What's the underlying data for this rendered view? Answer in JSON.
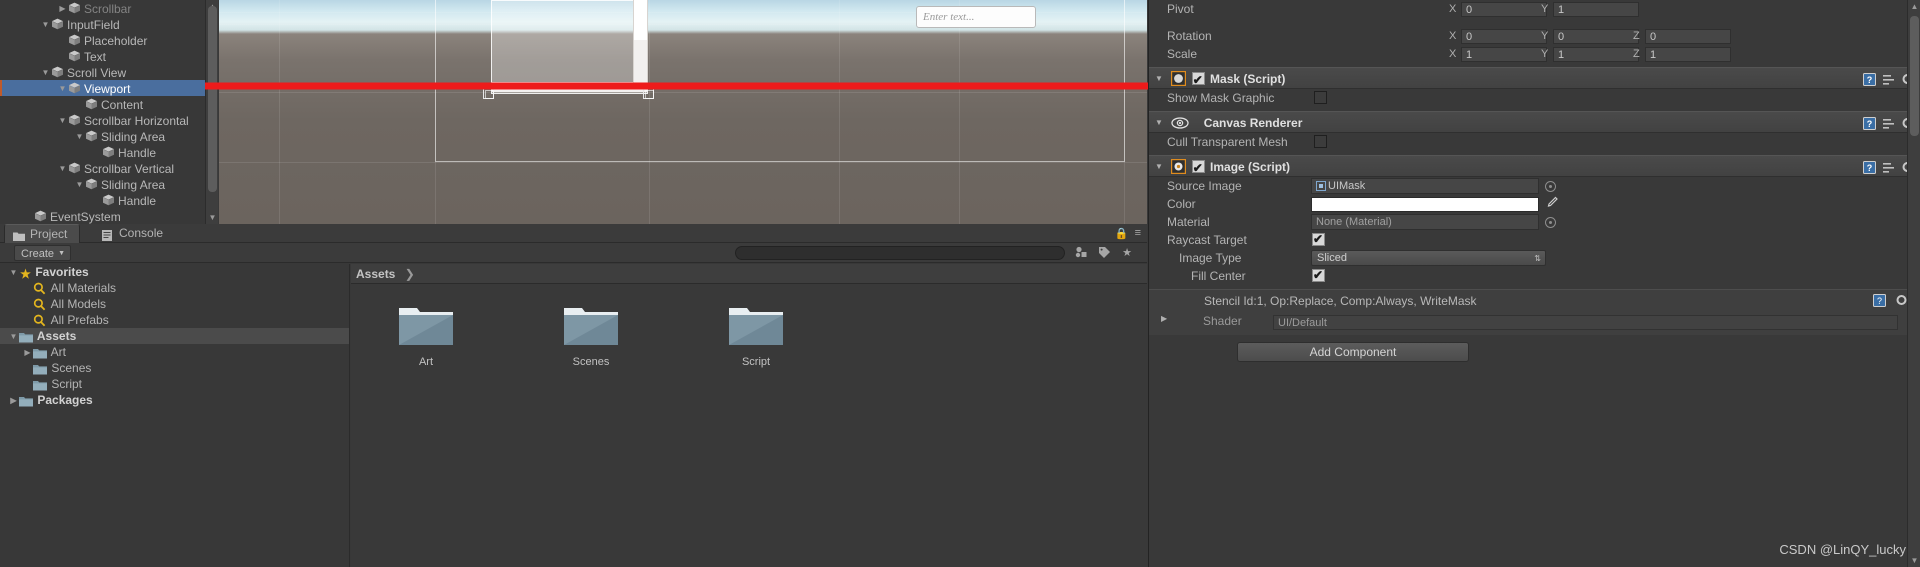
{
  "hierarchy": {
    "items": [
      {
        "label": "Scrollbar",
        "indent": 3,
        "tri": "right",
        "dim": true,
        "selected": false
      },
      {
        "label": "InputField",
        "indent": 2,
        "tri": "down",
        "dim": false,
        "selected": false
      },
      {
        "label": "Placeholder",
        "indent": 3,
        "tri": "none",
        "dim": false,
        "selected": false
      },
      {
        "label": "Text",
        "indent": 3,
        "tri": "none",
        "dim": false,
        "selected": false
      },
      {
        "label": "Scroll View",
        "indent": 2,
        "tri": "down",
        "dim": false,
        "selected": false
      },
      {
        "label": "Viewport",
        "indent": 3,
        "tri": "down",
        "dim": false,
        "selected": true
      },
      {
        "label": "Content",
        "indent": 4,
        "tri": "none",
        "dim": false,
        "selected": false
      },
      {
        "label": "Scrollbar Horizontal",
        "indent": 3,
        "tri": "down",
        "dim": false,
        "selected": false
      },
      {
        "label": "Sliding Area",
        "indent": 4,
        "tri": "down",
        "dim": false,
        "selected": false
      },
      {
        "label": "Handle",
        "indent": 5,
        "tri": "none",
        "dim": false,
        "selected": false
      },
      {
        "label": "Scrollbar Vertical",
        "indent": 3,
        "tri": "down",
        "dim": false,
        "selected": false
      },
      {
        "label": "Sliding Area",
        "indent": 4,
        "tri": "down",
        "dim": false,
        "selected": false
      },
      {
        "label": "Handle",
        "indent": 5,
        "tri": "none",
        "dim": false,
        "selected": false
      },
      {
        "label": "EventSystem",
        "indent": 1,
        "tri": "none",
        "dim": false,
        "selected": false
      }
    ]
  },
  "scene": {
    "input_field_placeholder": "Enter text..."
  },
  "project": {
    "tabs": [
      {
        "label": "Project",
        "icon": "folder-icon",
        "active": true
      },
      {
        "label": "Console",
        "icon": "console-icon",
        "active": false
      }
    ],
    "create_button": "Create",
    "search_placeholder": "",
    "breadcrumb": "Assets",
    "breadcrumb_chevron": "❯",
    "tree": [
      {
        "label": "Favorites",
        "type": "favorites",
        "indent": 0,
        "tri": "down",
        "bold": true,
        "highlight": false
      },
      {
        "label": "All Materials",
        "type": "search",
        "indent": 1,
        "tri": "none",
        "bold": false,
        "highlight": false
      },
      {
        "label": "All Models",
        "type": "search",
        "indent": 1,
        "tri": "none",
        "bold": false,
        "highlight": false
      },
      {
        "label": "All Prefabs",
        "type": "search",
        "indent": 1,
        "tri": "none",
        "bold": false,
        "highlight": false
      },
      {
        "label": "Assets",
        "type": "folder",
        "indent": 0,
        "tri": "down",
        "bold": true,
        "highlight": true
      },
      {
        "label": "Art",
        "type": "folder",
        "indent": 1,
        "tri": "right",
        "bold": false,
        "highlight": false
      },
      {
        "label": "Scenes",
        "type": "folder",
        "indent": 1,
        "tri": "none",
        "bold": false,
        "highlight": false
      },
      {
        "label": "Script",
        "type": "folder",
        "indent": 1,
        "tri": "none",
        "bold": false,
        "highlight": false
      },
      {
        "label": "Packages",
        "type": "folder",
        "indent": 0,
        "tri": "right",
        "bold": true,
        "highlight": false
      }
    ],
    "assets": [
      {
        "label": "Art"
      },
      {
        "label": "Scenes"
      },
      {
        "label": "Script"
      }
    ]
  },
  "inspector": {
    "transform": {
      "rows": [
        {
          "label": "Pivot",
          "fields": [
            {
              "axis": "X",
              "value": "0"
            },
            {
              "axis": "Y",
              "value": "1"
            }
          ]
        },
        {
          "label": "Rotation",
          "fields": [
            {
              "axis": "X",
              "value": "0"
            },
            {
              "axis": "Y",
              "value": "0"
            },
            {
              "axis": "Z",
              "value": "0"
            }
          ]
        },
        {
          "label": "Scale",
          "fields": [
            {
              "axis": "X",
              "value": "1"
            },
            {
              "axis": "Y",
              "value": "1"
            },
            {
              "axis": "Z",
              "value": "1"
            }
          ]
        }
      ]
    },
    "mask": {
      "title": "Mask (Script)",
      "enabled": true,
      "show_mask_graphic_label": "Show Mask Graphic",
      "show_mask_graphic_value": false
    },
    "canvas_renderer": {
      "title": "Canvas Renderer",
      "cull_transparent_mesh_label": "Cull Transparent Mesh",
      "cull_transparent_mesh_value": false
    },
    "image": {
      "title": "Image (Script)",
      "enabled": true,
      "source_image_label": "Source Image",
      "source_image_value": "UIMask",
      "color_label": "Color",
      "color_value": "#ffffff",
      "material_label": "Material",
      "material_value": "None (Material)",
      "raycast_target_label": "Raycast Target",
      "raycast_target_value": true,
      "image_type_label": "Image Type",
      "image_type_value": "Sliced",
      "fill_center_label": "Fill Center",
      "fill_center_value": true
    },
    "material_preview": {
      "stencil_text": "Stencil Id:1, Op:Replace, Comp:Always, WriteMask",
      "shader_label": "Shader",
      "shader_value": "UI/Default"
    },
    "add_component_label": "Add Component"
  },
  "watermark": "CSDN @LinQY_lucky",
  "colors": {
    "selection_blue": "#4a6e9e",
    "annotation_red": "#ee1b1b",
    "favorites_gold": "#e3b51e"
  }
}
